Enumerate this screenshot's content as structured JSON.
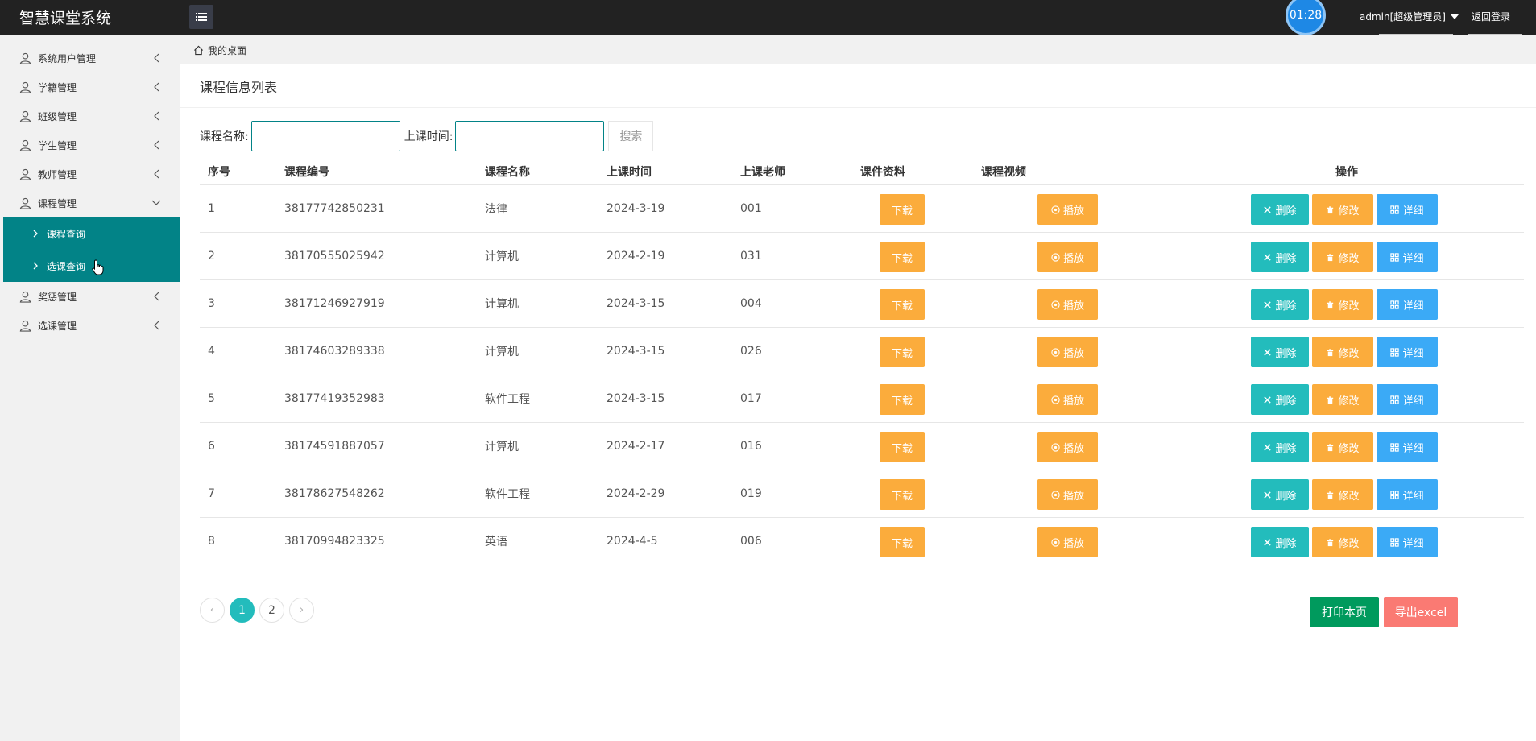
{
  "app": {
    "title": "智慧课堂系统"
  },
  "header": {
    "clock": "01:28",
    "user": "admin[超级管理员]",
    "logout": "返回登录"
  },
  "sidebar": {
    "items": [
      {
        "label": "系统用户管理"
      },
      {
        "label": "学籍管理"
      },
      {
        "label": "班级管理"
      },
      {
        "label": "学生管理"
      },
      {
        "label": "教师管理"
      },
      {
        "label": "课程管理"
      },
      {
        "label": "奖惩管理"
      },
      {
        "label": "选课管理"
      }
    ],
    "submenu": [
      {
        "label": "课程查询"
      },
      {
        "label": "选课查询"
      }
    ]
  },
  "breadcrumb": {
    "home": "我的桌面"
  },
  "panel": {
    "title": "课程信息列表"
  },
  "search": {
    "name_label": "课程名称:",
    "time_label": "上课时间:",
    "button": "搜索",
    "name_value": "",
    "time_value": ""
  },
  "table": {
    "headers": [
      "序号",
      "课程编号",
      "课程名称",
      "上课时间",
      "上课老师",
      "课件资料",
      "课程视频",
      "操作"
    ],
    "rows": [
      {
        "idx": "1",
        "code": "38177742850231",
        "name": "法律",
        "time": "2024-3-19",
        "teacher": "001"
      },
      {
        "idx": "2",
        "code": "38170555025942",
        "name": "计算机",
        "time": "2024-2-19",
        "teacher": "031"
      },
      {
        "idx": "3",
        "code": "38171246927919",
        "name": "计算机",
        "time": "2024-3-15",
        "teacher": "004"
      },
      {
        "idx": "4",
        "code": "38174603289338",
        "name": "计算机",
        "time": "2024-3-15",
        "teacher": "026"
      },
      {
        "idx": "5",
        "code": "38177419352983",
        "name": "软件工程",
        "time": "2024-3-15",
        "teacher": "017"
      },
      {
        "idx": "6",
        "code": "38174591887057",
        "name": "计算机",
        "time": "2024-2-17",
        "teacher": "016"
      },
      {
        "idx": "7",
        "code": "38178627548262",
        "name": "软件工程",
        "time": "2024-2-29",
        "teacher": "019"
      },
      {
        "idx": "8",
        "code": "38170994823325",
        "name": "英语",
        "time": "2024-4-5",
        "teacher": "006"
      }
    ],
    "buttons": {
      "download": "下载",
      "play": "播放",
      "delete": "删除",
      "modify": "修改",
      "detail": "详细"
    }
  },
  "pager": {
    "prev": "‹",
    "next": "›",
    "pages": [
      "1",
      "2"
    ],
    "current": "1"
  },
  "actions": {
    "print": "打印本页",
    "excel": "导出excel"
  },
  "colors": {
    "teal": "#028387",
    "accent": "#23bcbc",
    "orange": "#fbac3c",
    "blue": "#3baaf6",
    "green": "#009a5d",
    "red": "#fa7a73"
  }
}
